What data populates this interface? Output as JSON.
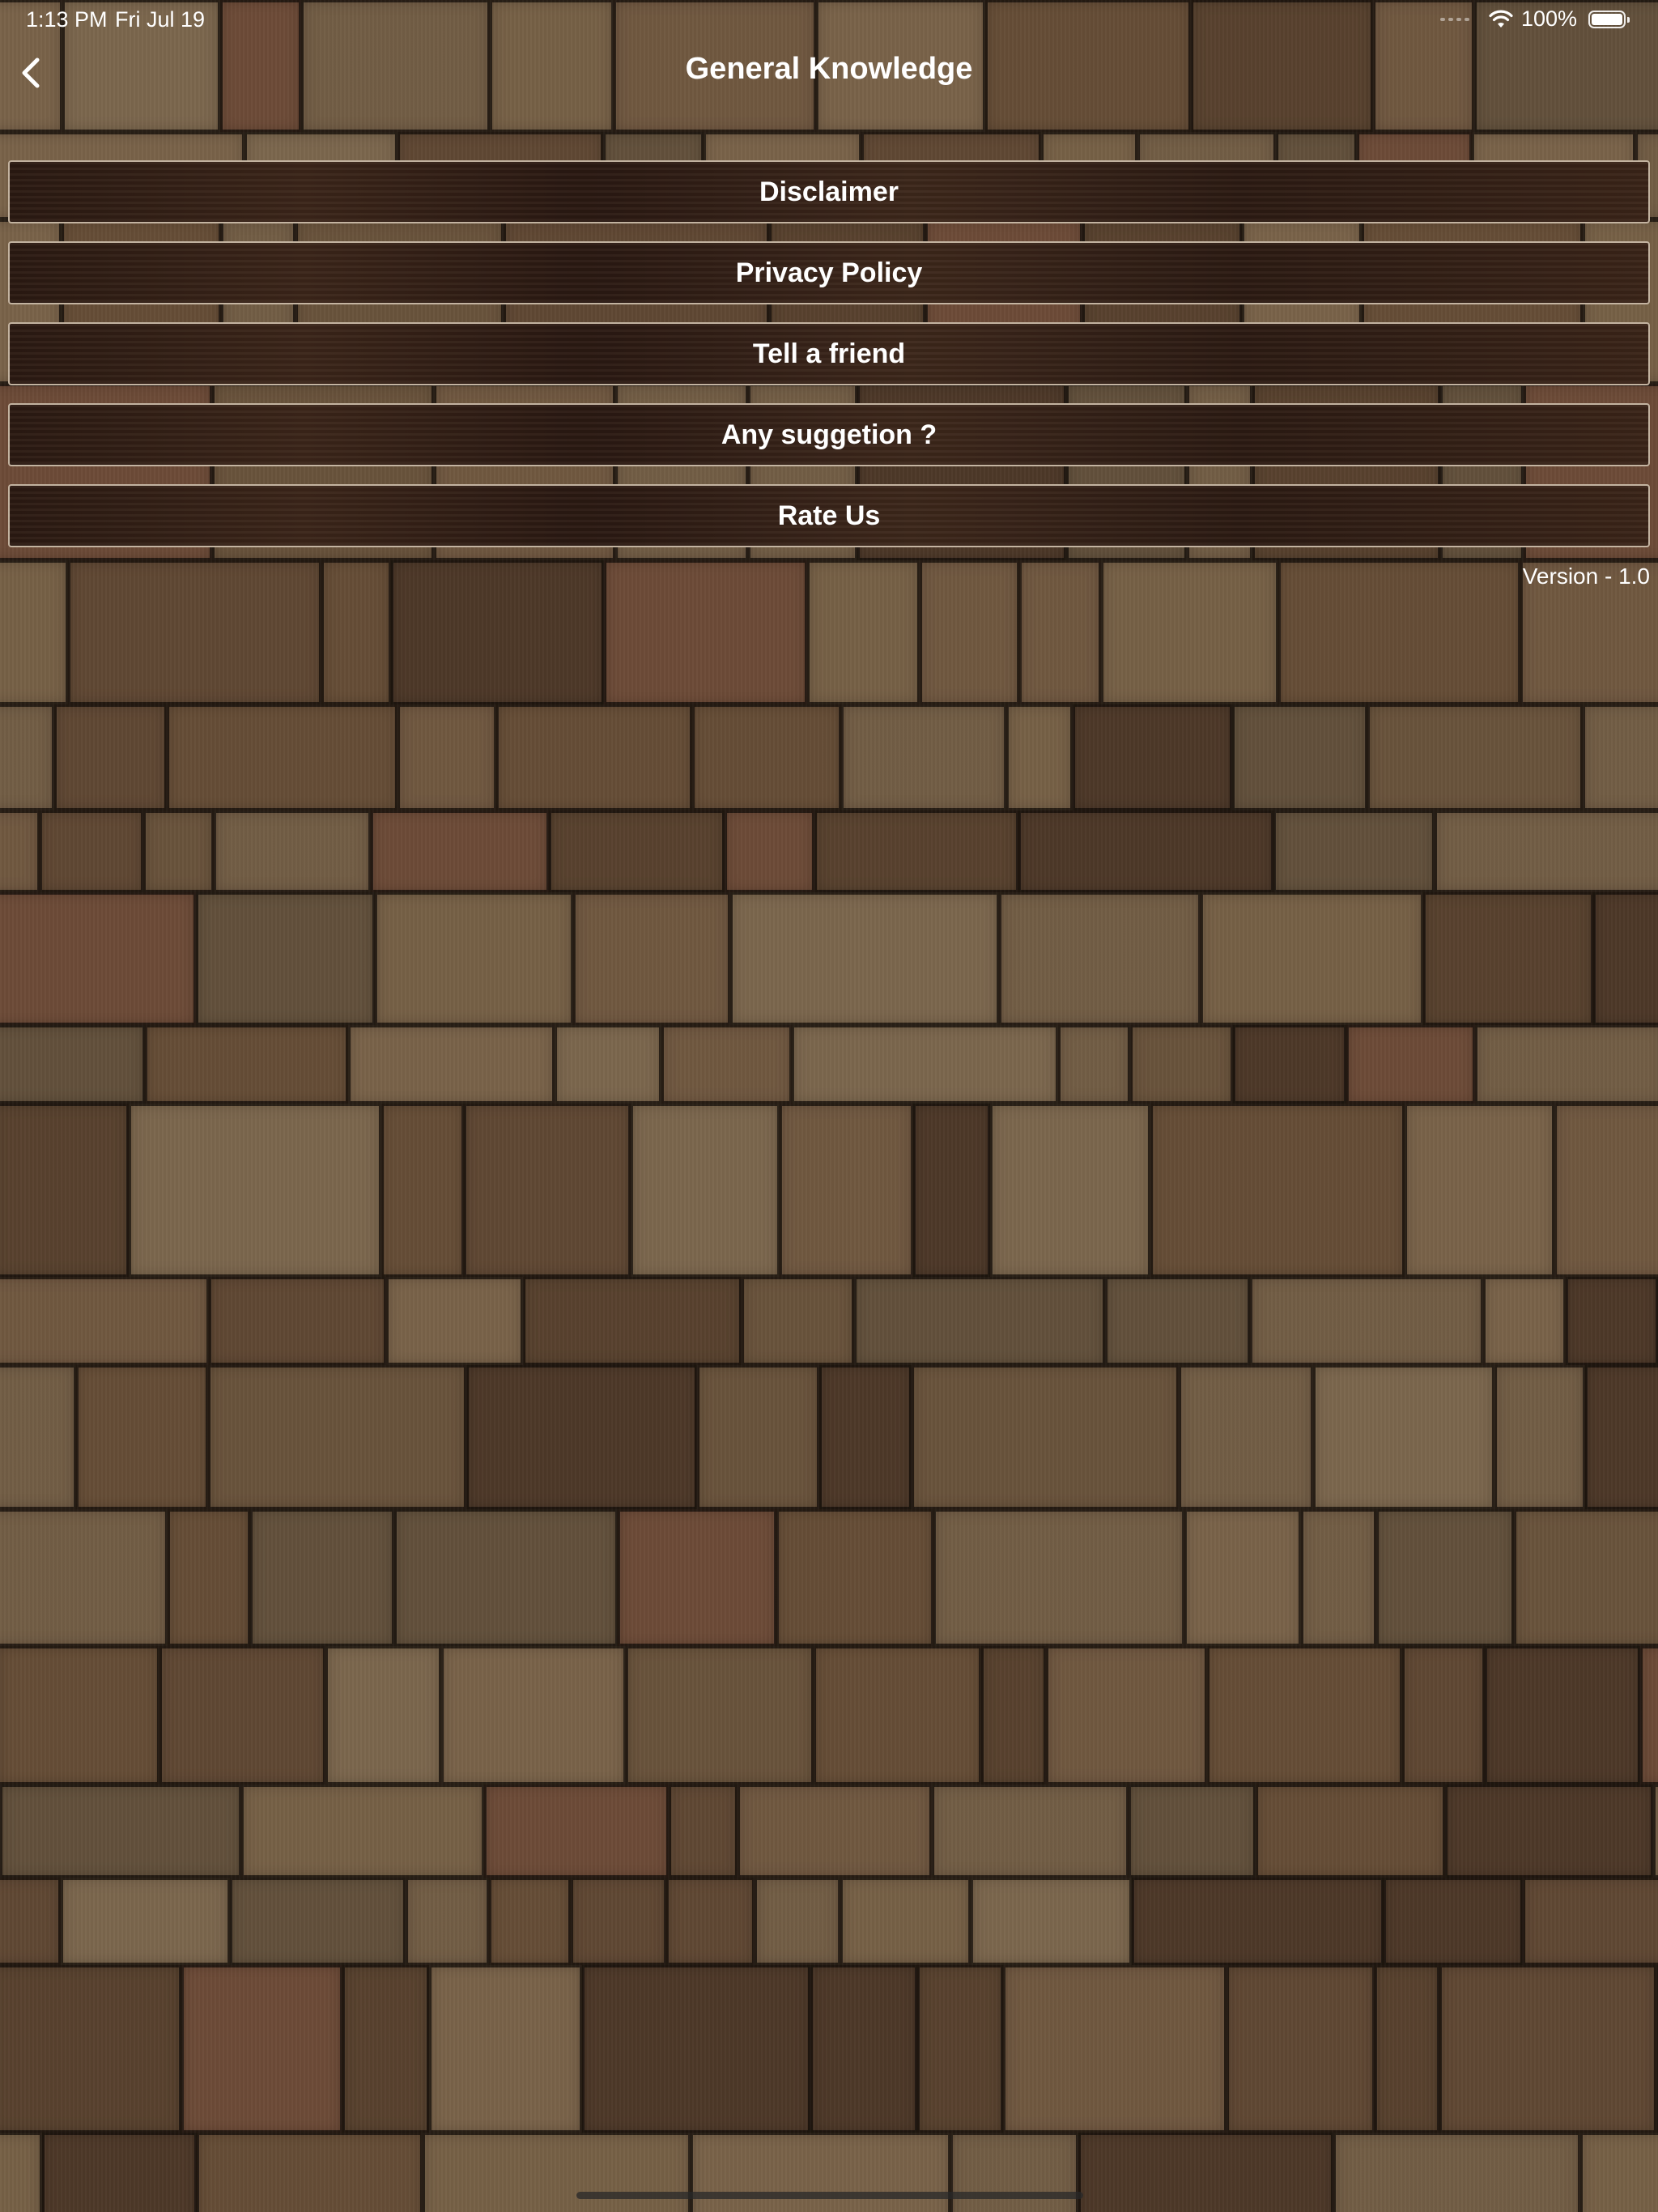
{
  "status_bar": {
    "time": "1:13 PM",
    "date": "Fri Jul 19",
    "battery": "100%",
    "icons": [
      "wifi-icon",
      "battery-icon"
    ]
  },
  "nav": {
    "title": "General Knowledge",
    "back_icon": "chevron-left-icon"
  },
  "menu": {
    "items": [
      {
        "label": "Disclaimer"
      },
      {
        "label": "Privacy Policy"
      },
      {
        "label": "Tell a friend"
      },
      {
        "label": "Any suggetion ?"
      },
      {
        "label": "Rate Us"
      }
    ]
  },
  "footer": {
    "version": "Version - 1.0"
  },
  "colors": {
    "text": "#ffffff",
    "button_border": "#dccdb9",
    "button_bg": "#2f1d14"
  }
}
